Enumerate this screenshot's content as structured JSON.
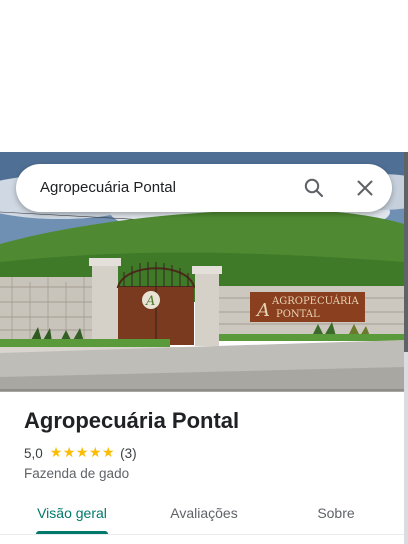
{
  "search": {
    "query": "Agropecuária Pontal"
  },
  "hero": {
    "sign_line1": "AGROPECUÁRIA",
    "sign_line2": "PONTAL"
  },
  "place": {
    "name": "Agropecuária Pontal",
    "rating": "5,0",
    "stars": 5,
    "review_count": "(3)",
    "category": "Fazenda de gado"
  },
  "tabs": [
    {
      "label": "Visão geral",
      "active": true
    },
    {
      "label": "Avaliações",
      "active": false
    },
    {
      "label": "Sobre",
      "active": false
    }
  ],
  "colors": {
    "accent": "#00796b",
    "star": "#fbbc04",
    "text": "#202124"
  }
}
